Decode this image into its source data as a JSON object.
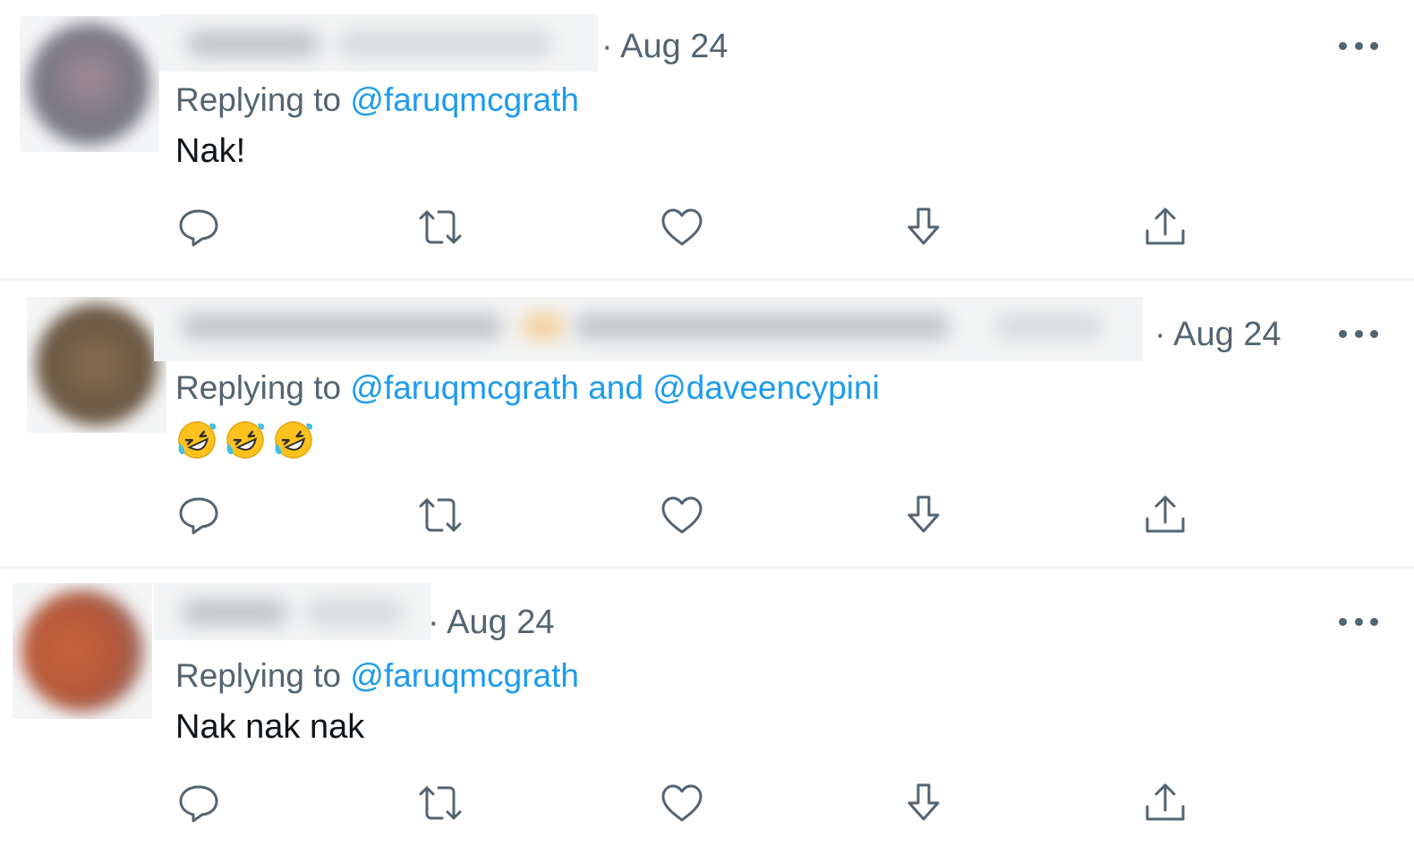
{
  "tweets": [
    {
      "date": "· Aug 24",
      "replying_prefix": "Replying to",
      "mentions": [
        "@faruqmcgrath"
      ],
      "joiner": "",
      "text": "Nak!",
      "emoji": [],
      "avatar_color": "#7d7a85"
    },
    {
      "date": "· Aug 24",
      "replying_prefix": "Replying to",
      "mentions": [
        "@faruqmcgrath",
        "@daveencypini"
      ],
      "joiner": "and",
      "text": "",
      "emoji": [
        "rolling-on-floor-laughing",
        "rolling-on-floor-laughing",
        "rolling-on-floor-laughing"
      ],
      "avatar_color": "#6f5a44"
    },
    {
      "date": "· Aug 24",
      "replying_prefix": "Replying to",
      "mentions": [
        "@faruqmcgrath"
      ],
      "joiner": "",
      "text": "Nak nak nak",
      "emoji": [],
      "avatar_color": "#b4583a"
    }
  ],
  "actions": [
    "reply-icon",
    "retweet-icon",
    "like-icon",
    "download-icon",
    "share-icon"
  ],
  "colors": {
    "mention": "#1d9bf0",
    "secondary_text": "#536471",
    "primary_text": "#0f1419",
    "divider": "#eff3f4"
  }
}
